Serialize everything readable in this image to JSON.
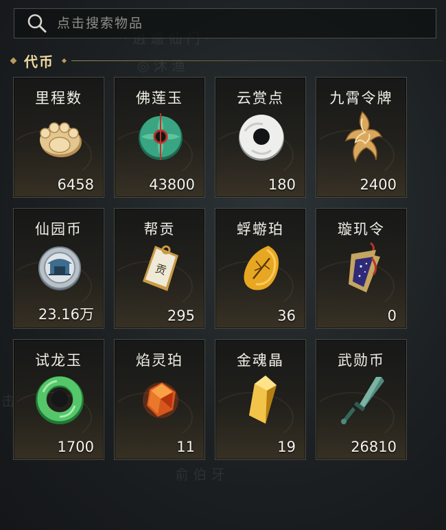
{
  "search": {
    "placeholder": "点击搜索物品"
  },
  "section": {
    "title": "代币"
  },
  "items": [
    {
      "name": "里程数",
      "count": "6458",
      "icon": "paw-icon"
    },
    {
      "name": "佛莲玉",
      "count": "43800",
      "icon": "jade-disc-icon"
    },
    {
      "name": "云赏点",
      "count": "180",
      "icon": "white-jade-ring-icon"
    },
    {
      "name": "九霄令牌",
      "count": "2400",
      "icon": "flame-token-icon"
    },
    {
      "name": "仙园币",
      "count": "23.16万",
      "icon": "pavilion-coin-icon"
    },
    {
      "name": "帮贡",
      "count": "295",
      "icon": "contribution-tag-icon"
    },
    {
      "name": "蜉蝣珀",
      "count": "36",
      "icon": "amber-insect-icon"
    },
    {
      "name": "璇玑令",
      "count": "0",
      "icon": "starry-pendant-icon"
    },
    {
      "name": "试龙玉",
      "count": "1700",
      "icon": "dragon-jade-icon"
    },
    {
      "name": "焰灵珀",
      "count": "11",
      "icon": "fire-amber-icon"
    },
    {
      "name": "金魂晶",
      "count": "19",
      "icon": "gold-crystal-icon"
    },
    {
      "name": "武勋币",
      "count": "26810",
      "icon": "sword-coin-icon"
    }
  ],
  "colors": {
    "accent": "#efd9a0",
    "card_border": "#4b4a44",
    "divider": "#9b8453"
  }
}
